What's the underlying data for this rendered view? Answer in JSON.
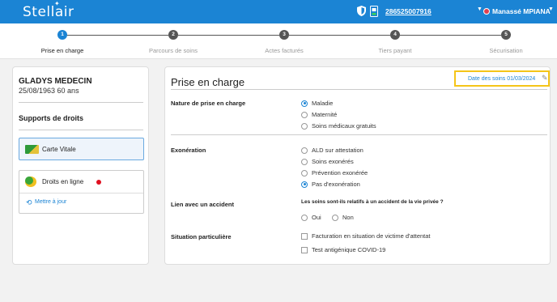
{
  "header": {
    "logo": "Stellair",
    "card_number": "286525007916",
    "user_name": "Manassé MPIANA",
    "icons": [
      "shield-icon",
      "card-reader-icon",
      "chevron-down-icon"
    ],
    "accent_color": "#1b84d4"
  },
  "stepper": {
    "steps": [
      {
        "number": "1",
        "label": "Prise en charge",
        "active": true
      },
      {
        "number": "2",
        "label": "Parcours de soins",
        "active": false
      },
      {
        "number": "3",
        "label": "Actes facturés",
        "active": false
      },
      {
        "number": "4",
        "label": "Tiers payant",
        "active": false
      },
      {
        "number": "5",
        "label": "Sécurisation",
        "active": false
      }
    ]
  },
  "patient": {
    "name": "GLADYS MEDECIN",
    "info": "25/08/1963 60 ans"
  },
  "supports": {
    "title": "Supports de droits",
    "vitale_label": "Carte Vitale",
    "droits_label": "Droits en ligne",
    "update_link": "Mettre à jour"
  },
  "main": {
    "title": "Prise en charge",
    "date_label": "Date des soins 01/03/2024",
    "nature": {
      "label": "Nature de prise en charge",
      "options": [
        "Maladie",
        "Maternité",
        "Soins médicaux gratuits"
      ],
      "selected": "Maladie"
    },
    "exoneration": {
      "label": "Exonération",
      "options": [
        "ALD sur attestation",
        "Soins exonérés",
        "Prévention exonérée",
        "Pas d'exonération"
      ],
      "selected": "Pas d'exonération"
    },
    "accident": {
      "label": "Lien avec un accident",
      "question": "Les soins sont-ils relatifs à un accident de la vie privée ?",
      "oui": "Oui",
      "non": "Non"
    },
    "situation": {
      "label": "Situation particulière",
      "options": [
        "Facturation en situation de victime d'attentat",
        "Test antigénique COVID-19"
      ]
    }
  }
}
